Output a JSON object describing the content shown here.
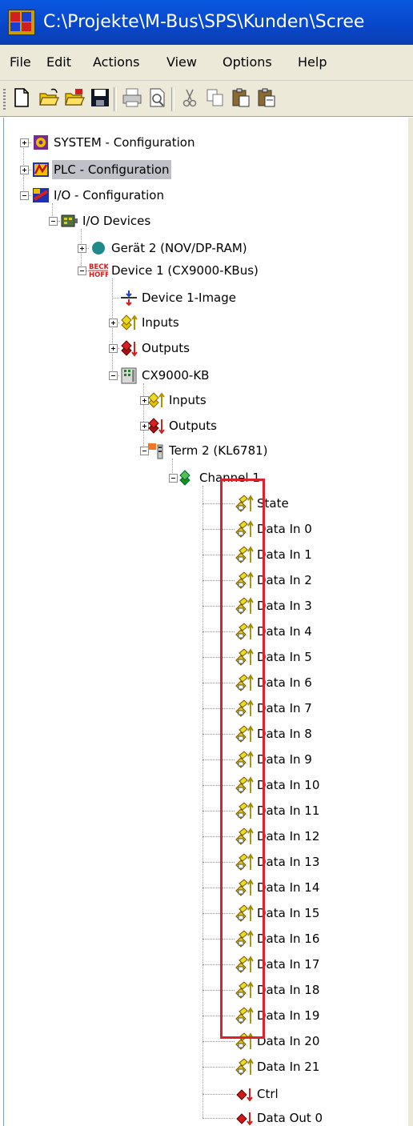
{
  "window": {
    "title": "C:\\Projekte\\M-Bus\\SPS\\Kunden\\Scree"
  },
  "menubar": {
    "items": [
      "File",
      "Edit",
      "Actions",
      "View",
      "Options",
      "Help"
    ]
  },
  "toolbar": {
    "buttons": [
      "new-file-icon",
      "open-icon",
      "open-from-target-icon",
      "save-icon",
      "print-icon",
      "print-preview-icon",
      "cut-icon",
      "copy-icon",
      "paste-icon",
      "paste-with-links-icon"
    ]
  },
  "tree": {
    "nodes": [
      {
        "label": "SYSTEM - Configuration",
        "icon": "system-config-icon",
        "expander": "plus",
        "selected": false
      },
      {
        "label": "PLC - Configuration",
        "icon": "plc-config-icon",
        "expander": "plus",
        "selected": true
      },
      {
        "label": "I/O - Configuration",
        "icon": "io-config-icon",
        "expander": "minus",
        "selected": false
      },
      {
        "label": "I/O Devices",
        "icon": "io-devices-icon",
        "expander": "minus",
        "selected": false
      },
      {
        "label": "Gerät 2 (NOV/DP-RAM)",
        "icon": "device-round-icon",
        "expander": "plus",
        "selected": false
      },
      {
        "label": "Device 1 (CX9000-KBus)",
        "icon": "beckhoff-icon",
        "expander": "minus",
        "selected": false
      },
      {
        "label": "Device 1-Image",
        "icon": "process-image-icon",
        "expander": "none",
        "selected": false
      },
      {
        "label": "Inputs",
        "icon": "inputs-icon",
        "expander": "plus",
        "selected": false
      },
      {
        "label": "Outputs",
        "icon": "outputs-icon",
        "expander": "plus",
        "selected": false
      },
      {
        "label": "CX9000-KB",
        "icon": "bus-coupler-icon",
        "expander": "minus",
        "selected": false
      },
      {
        "label": "Inputs",
        "icon": "inputs-icon",
        "expander": "plus",
        "selected": false
      },
      {
        "label": "Outputs",
        "icon": "outputs-icon",
        "expander": "plus",
        "selected": false
      },
      {
        "label": "Term 2 (KL6781)",
        "icon": "terminal-icon",
        "expander": "minus",
        "selected": false
      },
      {
        "label": "Channel 1",
        "icon": "channel-icon",
        "expander": "minus",
        "selected": false
      },
      {
        "label": "State",
        "icon": "input-var-icon",
        "expander": "none",
        "selected": false
      },
      {
        "label": "Data In 0",
        "icon": "input-var-icon",
        "expander": "none",
        "selected": false
      },
      {
        "label": "Data In 1",
        "icon": "input-var-icon",
        "expander": "none",
        "selected": false
      },
      {
        "label": "Data In 2",
        "icon": "input-var-icon",
        "expander": "none",
        "selected": false
      },
      {
        "label": "Data In 3",
        "icon": "input-var-icon",
        "expander": "none",
        "selected": false
      },
      {
        "label": "Data In 4",
        "icon": "input-var-icon",
        "expander": "none",
        "selected": false
      },
      {
        "label": "Data In 5",
        "icon": "input-var-icon",
        "expander": "none",
        "selected": false
      },
      {
        "label": "Data In 6",
        "icon": "input-var-icon",
        "expander": "none",
        "selected": false
      },
      {
        "label": "Data In 7",
        "icon": "input-var-icon",
        "expander": "none",
        "selected": false
      },
      {
        "label": "Data In 8",
        "icon": "input-var-icon",
        "expander": "none",
        "selected": false
      },
      {
        "label": "Data In 9",
        "icon": "input-var-icon",
        "expander": "none",
        "selected": false
      },
      {
        "label": "Data In 10",
        "icon": "input-var-icon",
        "expander": "none",
        "selected": false
      },
      {
        "label": "Data In 11",
        "icon": "input-var-icon",
        "expander": "none",
        "selected": false
      },
      {
        "label": "Data In 12",
        "icon": "input-var-icon",
        "expander": "none",
        "selected": false
      },
      {
        "label": "Data In 13",
        "icon": "input-var-icon",
        "expander": "none",
        "selected": false
      },
      {
        "label": "Data In 14",
        "icon": "input-var-icon",
        "expander": "none",
        "selected": false
      },
      {
        "label": "Data In 15",
        "icon": "input-var-icon",
        "expander": "none",
        "selected": false
      },
      {
        "label": "Data In 16",
        "icon": "input-var-icon",
        "expander": "none",
        "selected": false
      },
      {
        "label": "Data In 17",
        "icon": "input-var-icon",
        "expander": "none",
        "selected": false
      },
      {
        "label": "Data In 18",
        "icon": "input-var-icon",
        "expander": "none",
        "selected": false
      },
      {
        "label": "Data In 19",
        "icon": "input-var-icon",
        "expander": "none",
        "selected": false
      },
      {
        "label": "Data In 20",
        "icon": "input-var-icon",
        "expander": "none",
        "selected": false
      },
      {
        "label": "Data In 21",
        "icon": "input-var-icon",
        "expander": "none",
        "selected": false
      },
      {
        "label": "Ctrl",
        "icon": "output-var-icon",
        "expander": "none",
        "selected": false
      },
      {
        "label": "Data Out 0",
        "icon": "output-var-icon",
        "expander": "none",
        "selected": false
      }
    ]
  },
  "colors": {
    "titlebar": "#0a4fd8",
    "chrome": "#ece9d8",
    "selection": "#c0c0c8",
    "highlight_box": "#e0202a"
  }
}
